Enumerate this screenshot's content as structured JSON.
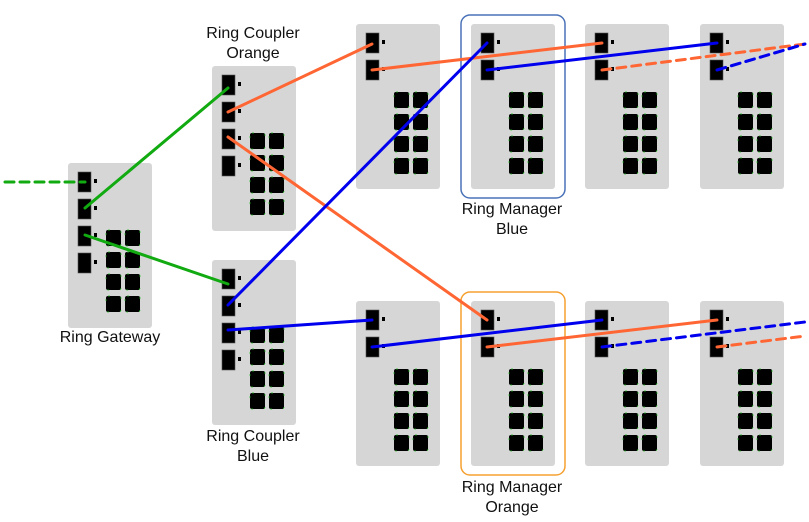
{
  "labels": {
    "ring_gateway": "Ring Gateway",
    "coupler_orange_1": "Ring Coupler",
    "coupler_orange_2": "Orange",
    "coupler_blue_1": "Ring Coupler",
    "coupler_blue_2": "Blue",
    "manager_blue_1": "Ring Manager",
    "manager_blue_2": "Blue",
    "manager_orange_1": "Ring Manager",
    "manager_orange_2": "Orange"
  },
  "colors": {
    "green": "#11aa11",
    "orange": "#ff6633",
    "blue": "#0000ee",
    "switch_body": "#d6d6d6",
    "port": "#000000",
    "port_led": "#22bb22",
    "highlight_blue": "#4a72b8",
    "highlight_orange": "#f5a030"
  }
}
